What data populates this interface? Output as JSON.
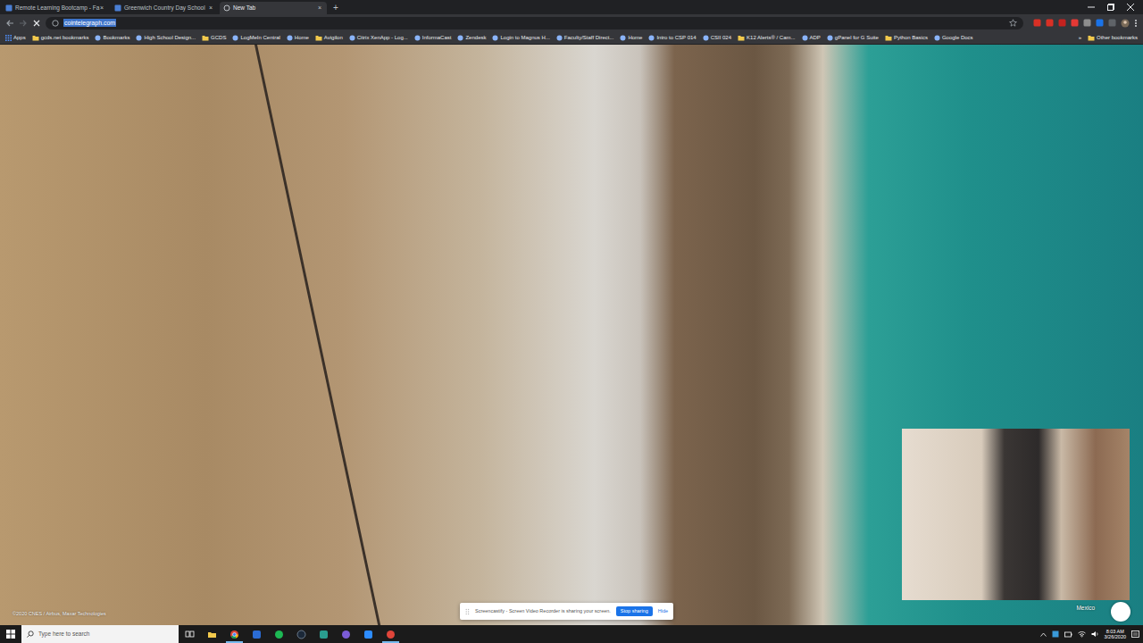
{
  "browser": {
    "tabs": [
      {
        "label": "Remote Learning Bootcamp - Fa",
        "selected": false,
        "close": "×"
      },
      {
        "label": "Greenwich Country Day School",
        "selected": false,
        "close": "×"
      },
      {
        "label": "New Tab",
        "selected": true,
        "close": "×"
      }
    ],
    "new_tab_button": "+",
    "address": {
      "text": "cointelegraph.com",
      "selected": true
    },
    "bookmarks": [
      {
        "label": "Apps",
        "kind": "apps"
      },
      {
        "label": "gcds.net bookmarks",
        "kind": "folder"
      },
      {
        "label": "Bookmarks",
        "kind": "link"
      },
      {
        "label": "High School Design...",
        "kind": "link"
      },
      {
        "label": "GCDS",
        "kind": "folder"
      },
      {
        "label": "LogMeIn Central",
        "kind": "link"
      },
      {
        "label": "Home",
        "kind": "link"
      },
      {
        "label": "Avigilon",
        "kind": "folder"
      },
      {
        "label": "Citrix XenApp - Log...",
        "kind": "link"
      },
      {
        "label": "InformaCast",
        "kind": "link"
      },
      {
        "label": "Zendesk",
        "kind": "link"
      },
      {
        "label": "Login to Magnus H...",
        "kind": "link"
      },
      {
        "label": "Faculty/Staff Direct...",
        "kind": "link"
      },
      {
        "label": "Home",
        "kind": "link"
      },
      {
        "label": "Intro to CSP 014",
        "kind": "link"
      },
      {
        "label": "CSII 024",
        "kind": "link"
      },
      {
        "label": "K12 Alerts® / Cam...",
        "kind": "folder"
      },
      {
        "label": "ADP",
        "kind": "link"
      },
      {
        "label": "gPanel for G Suite",
        "kind": "link"
      },
      {
        "label": "Python Basics",
        "kind": "folder"
      },
      {
        "label": "Google Docs",
        "kind": "link"
      }
    ],
    "bookmarks_overflow": "»",
    "other_bookmarks": "Other bookmarks"
  },
  "page": {
    "attribution": "©2020 CNES / Airbus, Maxar Technologies",
    "location": "Mexico"
  },
  "share_bar": {
    "message": "Screencastify - Screen Video Recorder is sharing your screen.",
    "stop": "Stop sharing",
    "hide": "Hide"
  },
  "taskbar": {
    "search_placeholder": "Type here to search",
    "time": "8:03 AM",
    "date": "3/26/2020"
  }
}
